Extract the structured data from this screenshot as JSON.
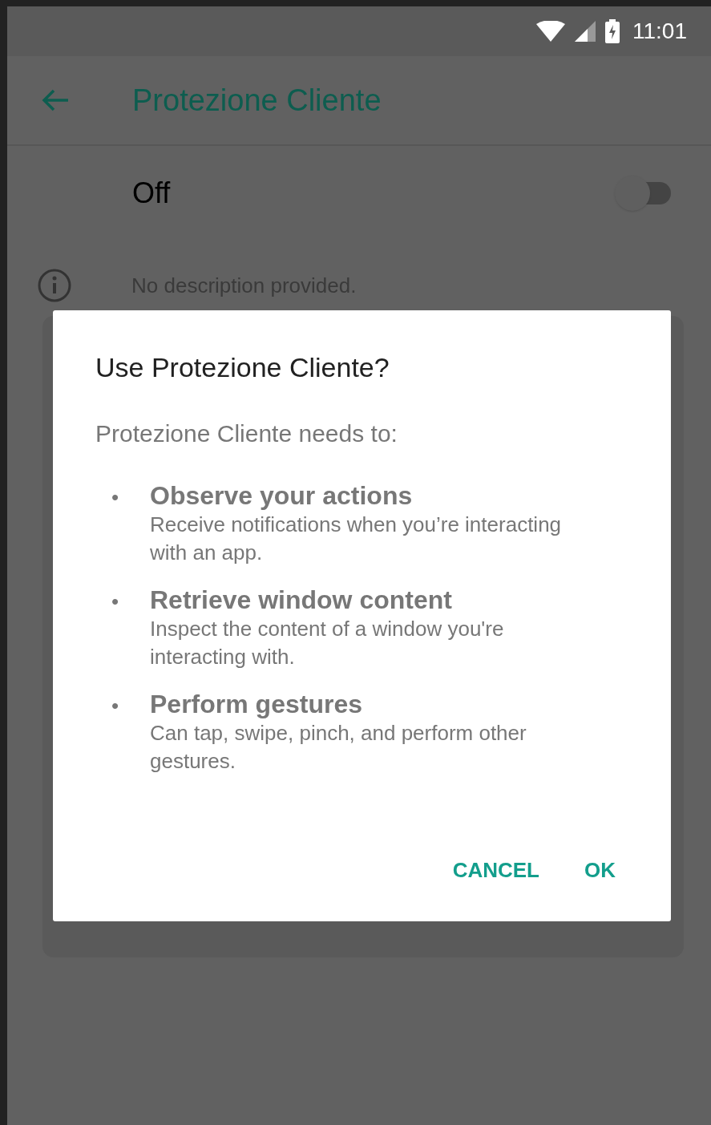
{
  "status_bar": {
    "time": "11:01"
  },
  "toolbar": {
    "title": "Protezione Cliente"
  },
  "switch": {
    "label": "Off",
    "on": false
  },
  "info": {
    "text": "No description provided."
  },
  "dialog": {
    "title": "Use Protezione Cliente?",
    "subtitle": "Protezione Cliente needs to:",
    "permissions": [
      {
        "bullet": "•",
        "title": "Observe your actions",
        "description": "Receive notifications when you’re interacting with an app."
      },
      {
        "bullet": "•",
        "title": "Retrieve window content",
        "description": "Inspect the content of a window you're interacting with."
      },
      {
        "bullet": "•",
        "title": "Perform gestures",
        "description": "Can tap, swipe, pinch, and perform other gestures."
      }
    ],
    "buttons": [
      "CANCEL",
      "OK"
    ]
  }
}
